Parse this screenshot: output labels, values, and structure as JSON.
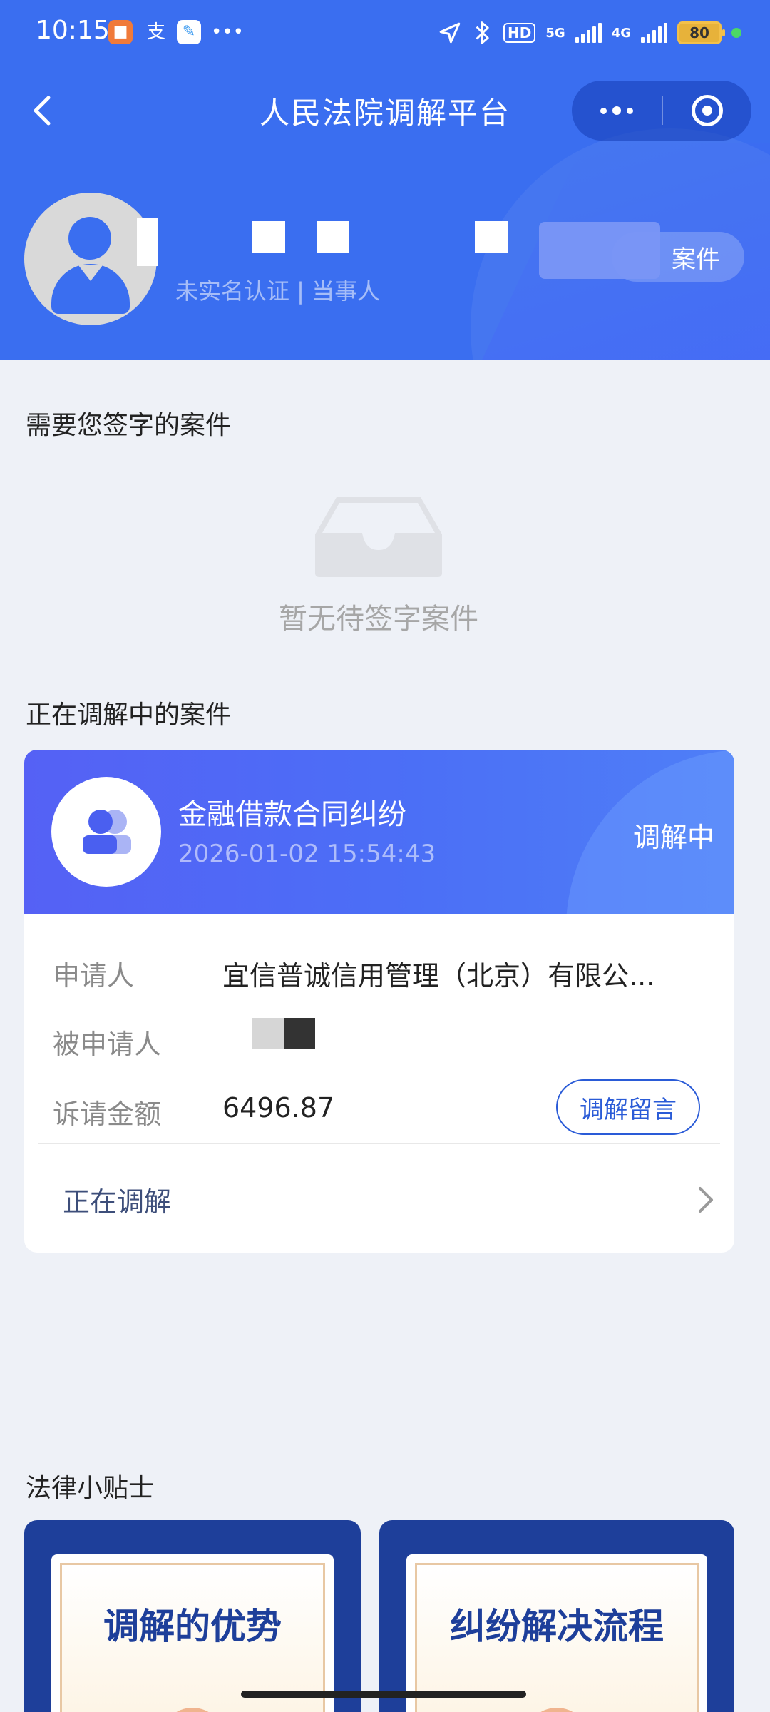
{
  "status_bar": {
    "time": "10:15",
    "more_dots": "•••",
    "hd_label": "HD",
    "net1": "5G",
    "net2": "4G",
    "battery": "80"
  },
  "nav": {
    "title": "人民法院调解平台"
  },
  "profile": {
    "subtitle": "未实名认证 | 当事人",
    "case_button": "案件"
  },
  "sign_section": {
    "title": "需要您签字的案件",
    "empty_text": "暂无待签字案件"
  },
  "mediation_section": {
    "title": "正在调解中的案件",
    "case": {
      "title": "金融借款合同纠纷",
      "time": "2026-01-02 15:54:43",
      "status": "调解中",
      "applicant_label": "申请人",
      "applicant_value": "宜信普诚信用管理（北京）有限公...",
      "respondent_label": "被申请人",
      "amount_label": "诉请金额",
      "amount_value": "6496.87",
      "message_button": "调解留言",
      "progress_text": "正在调解"
    }
  },
  "tips_section": {
    "title": "法律小贴士",
    "cards": [
      {
        "title": "调解的优势"
      },
      {
        "title": "纠纷解决流程"
      }
    ]
  },
  "colors": {
    "brand_blue": "#3a6ef0",
    "card_navy": "#1e3f9a",
    "link_blue": "#2a5bd7"
  }
}
